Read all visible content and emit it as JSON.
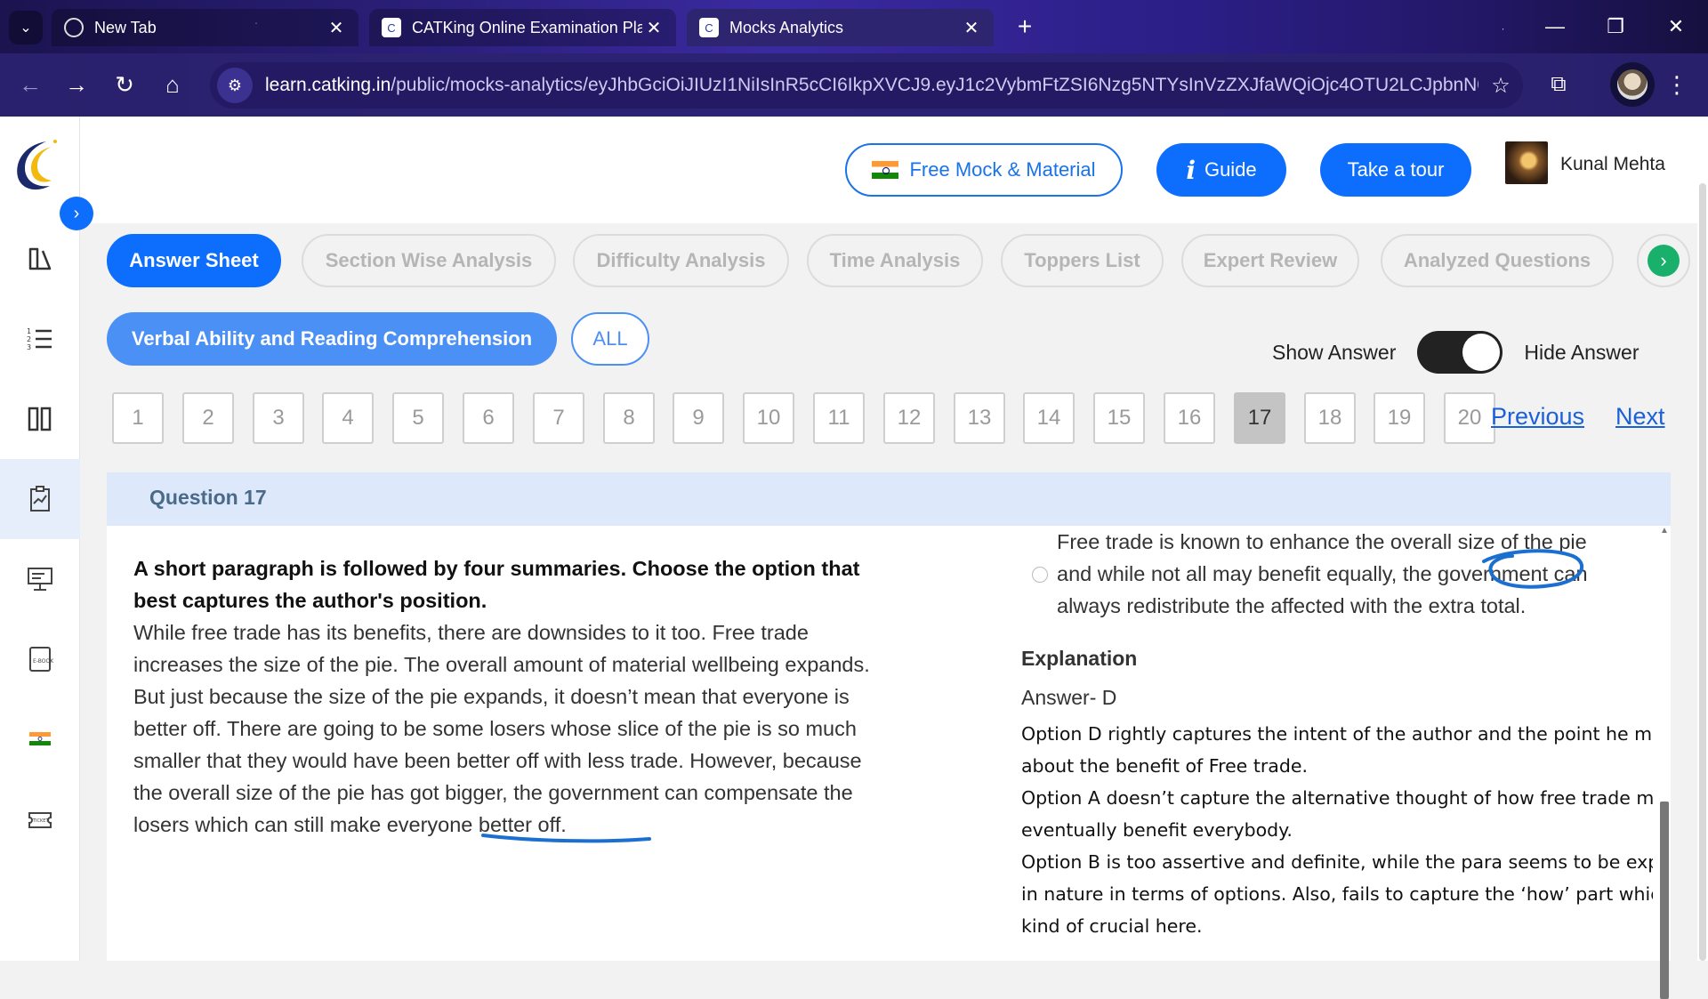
{
  "browser": {
    "tabs": [
      {
        "title": "New Tab",
        "favicon": "globe-icon",
        "active": false
      },
      {
        "title": "CATKing Online Examination Pla",
        "favicon": "catking-icon",
        "active": false
      },
      {
        "title": "Mocks Analytics",
        "favicon": "catking-icon",
        "active": true
      }
    ],
    "url_host": "learn.catking.in",
    "url_path": "/public/mocks-analytics/eyJhbGciOiJIUzI1NiIsInR5cCI6IkpXVCJ9.eyJ1c2VybmFtZSI6Nzg5NTYsInVzZXJfaWQiOjc4OTU2LCJpbnN0aX..."
  },
  "header": {
    "free_mock_label": "Free Mock & Material",
    "guide_label": "Guide",
    "tour_label": "Take a tour",
    "user_name": "Kunal Mehta"
  },
  "analysis_tabs": [
    "Answer Sheet",
    "Section Wise Analysis",
    "Difficulty Analysis",
    "Time Analysis",
    "Toppers List",
    "Expert Review",
    "Analyzed Questions"
  ],
  "sections": {
    "active": "Verbal Ability and Reading Comprehension",
    "all": "ALL"
  },
  "answer_toggle": {
    "show_label": "Show Answer",
    "hide_label": "Hide Answer"
  },
  "question_nav": {
    "numbers": [
      "1",
      "2",
      "3",
      "4",
      "5",
      "6",
      "7",
      "8",
      "9",
      "10",
      "11",
      "12",
      "13",
      "14",
      "15",
      "16",
      "17",
      "18",
      "19",
      "20"
    ],
    "current": "17",
    "previous_label": "Previous",
    "next_label": "Next"
  },
  "question": {
    "header": "Question 17",
    "lead": "A short paragraph is followed by four summaries. Choose the option that best captures the author's position.",
    "passage": "While free trade has its benefits, there are downsides to it too. Free trade increases the size of the pie. The overall amount of material wellbeing expands. But just because the size of the pie expands, it doesn’t mean that everyone is better off. There are going to be some losers whose slice of the pie is so much smaller that they would have been better off with less trade. However, because the overall size of the pie has got bigger, the government can compensate the losers which can still make everyone better off.",
    "option_text": "Free trade is known to enhance the overall size of the pie and while not all may benefit equally, the government can always redistribute the affected with the extra total.",
    "explanation_title": "Explanation",
    "answer_line": "Answer- D",
    "explanation_lines": [
      "Option D rightly captures the intent of the author and the point he makes about the benefit of Free trade.",
      "Option A doesn’t capture the alternative thought of how free trade may eventually benefit everybody.",
      "Option B is too assertive and definite, while the para seems to be exploratory in nature in terms of options. Also, fails to capture the ‘how’ part which is kind of crucial here."
    ]
  },
  "colors": {
    "primary": "#0d6efd",
    "ink_annotation": "#1a6fd1",
    "question_header_bg": "#dde9fb"
  }
}
